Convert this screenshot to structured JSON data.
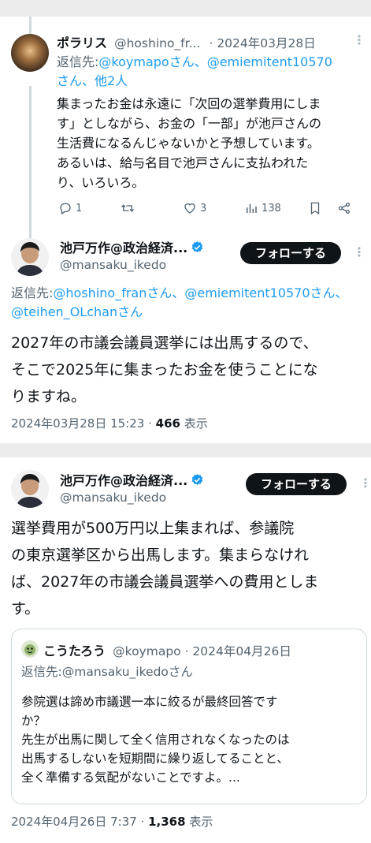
{
  "reply_tweet": {
    "author_name": "ポラリス",
    "handle": "@hoshino_fr...",
    "date": "· 2024年03月28日",
    "replying_prefix": "返信先:",
    "replying_to_line1": "@koymapoさん、@emiemitent10570",
    "replying_to_line2": "さん、他2人",
    "body_lines": [
      "集まったお金は永遠に「次回の選挙費用にしま",
      "す」としながら、お金の「一部」が池戸さんの",
      "生活費になるんじゃないかと予想しています。",
      "あるいは、給与名目で池戸さんに支払われた",
      "り、いろいろ。"
    ],
    "stats": {
      "replies": "1",
      "retweets": "",
      "likes": "3",
      "views": "138"
    }
  },
  "main_tweet": {
    "author_name": "池戸万作@政治経済...",
    "handle": "@mansaku_ikedo",
    "follow_label": "フォローする",
    "replying_prefix": "返信先:",
    "replying_to_line1": "@hoshino_franさん、@emiemitent10570さん、",
    "replying_to_line2": "@teihen_OLchanさん",
    "body_lines": [
      "2027年の市議会議員選挙には出馬するので、",
      "そこで2025年に集まったお金を使うことにな",
      "りますね。"
    ],
    "timestamp": "2024年03月28日 15:23 · ",
    "views_count": "466",
    "views_label": " 表示"
  },
  "second_tweet": {
    "author_name": "池戸万作@政治経済...",
    "handle": "@mansaku_ikedo",
    "follow_label": "フォローする",
    "body_lines": [
      "選挙費用が500万円以上集まれば、参議院",
      "の東京選挙区から出馬します。集まらなけれ",
      "ば、2027年の市議会議員選挙への費用としま",
      "す。"
    ],
    "quoted": {
      "author_name": "こうたろう",
      "handle_date": "@koymapo · 2024年04月26日",
      "replying_prefix": "返信先:",
      "replying_to": "@mansaku_ikedoさん",
      "body_lines": [
        "参院選は諦め市議選一本に絞るが最終回答です",
        "か？",
        "先生が出馬に関して全く信用されなくなったのは",
        "出馬するしないを短期間に繰り返してることと、",
        "全く準備する気配がないことですよ。..."
      ]
    },
    "timestamp": "2024年04月26日 7:37 · ",
    "views_count": "1,368",
    "views_label": " 表示"
  },
  "colors": {
    "accent": "#1d9bf0",
    "text": "#0f1419",
    "secondary": "#536471",
    "follow_bg": "#0f1419"
  },
  "icons": [
    "reply-icon",
    "retweet-icon",
    "like-icon",
    "views-icon",
    "bookmark-icon",
    "share-icon",
    "verified-badge-icon",
    "more-icon"
  ]
}
